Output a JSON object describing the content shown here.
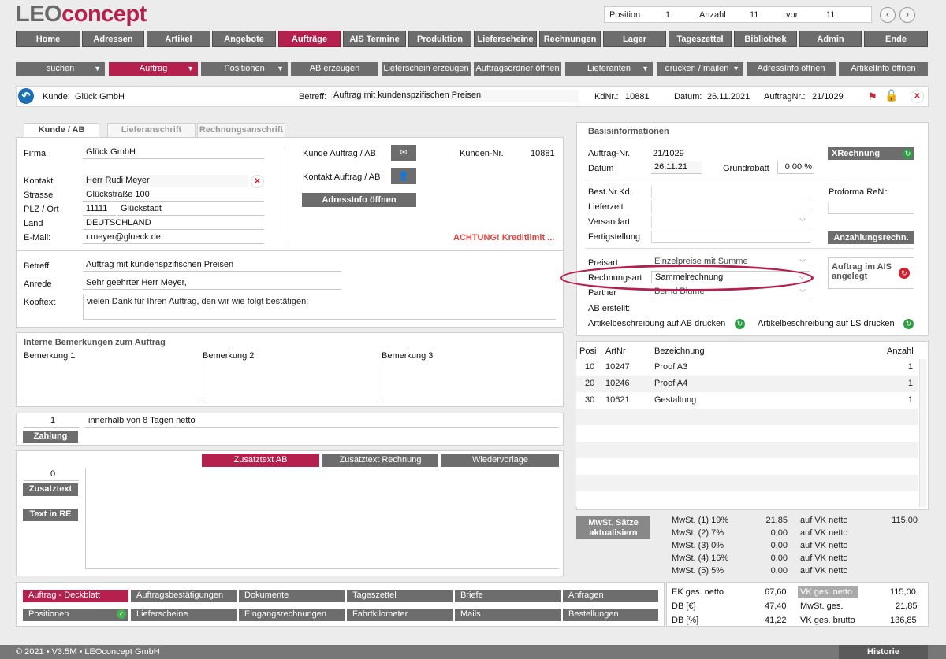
{
  "logo": {
    "part1": "LEO",
    "part2": "concept"
  },
  "position_box": {
    "position_label": "Position",
    "position_value": "1",
    "count_label": "Anzahl",
    "count_value": "11",
    "of_label": "von",
    "of_value": "11"
  },
  "nav": [
    "Home",
    "Adressen",
    "Artikel",
    "Angebote",
    "Aufträge",
    "AIS Termine",
    "Produktion",
    "Lieferscheine",
    "Rechnungen",
    "Lager",
    "Tageszettel",
    "Bibliothek",
    "Admin",
    "Ende"
  ],
  "nav_active": "Aufträge",
  "toolbar": {
    "suchen": "suchen",
    "auftrag": "Auftrag",
    "positionen": "Positionen",
    "ab_erzeugen": "AB erzeugen",
    "lieferschein": "Lieferschein erzeugen",
    "auftragsordner": "Auftragsordner öffnen",
    "lieferanten": "Lieferanten",
    "drucken": "drucken / mailen",
    "adressinfo": "AdressInfo öffnen",
    "artikelinfo": "ArtikelInfo öffnen"
  },
  "context": {
    "kunde_label": "Kunde:",
    "kunde_value": "Glück GmbH",
    "betreff_label": "Betreff:",
    "betreff_value": "Auftrag mit kundenspzifischen Preisen",
    "kdnr_label": "KdNr.:",
    "kdnr_value": "10881",
    "datum_label": "Datum:",
    "datum_value": "26.11.2021",
    "auftragnr_label": "AuftragNr.:",
    "auftragnr_value": "21/1029"
  },
  "tabs": [
    "Kunde / AB",
    "Lieferanschrift",
    "Rechnungsanschrift"
  ],
  "customer": {
    "firma_label": "Firma",
    "firma": "Glück GmbH",
    "kontakt_label": "Kontakt",
    "kontakt": "Herr Rudi Meyer",
    "strasse_label": "Strasse",
    "strasse": "Glückstraße 100",
    "plz_label": "PLZ / Ort",
    "plz": "11111",
    "ort": "Glückstadt",
    "land_label": "Land",
    "land": "DEUTSCHLAND",
    "email_label": "E-Mail:",
    "email": "r.meyer@glueck.de",
    "kunde_auftrag_label": "Kunde Auftrag / AB",
    "kontakt_auftrag_label": "Kontakt Auftrag / AB",
    "adressinfo_btn": "AdressInfo öffnen",
    "kundennr_label": "Kunden-Nr.",
    "kundennr": "10881",
    "warning": "ACHTUNG! Kreditlimit ..."
  },
  "betreff_section": {
    "betreff_label": "Betreff",
    "betreff": "Auftrag mit kundenspzifischen Preisen",
    "anrede_label": "Anrede",
    "anrede": "Sehr geehrter Herr Meyer,",
    "kopftext_label": "Kopftext",
    "kopftext": "vielen Dank für Ihren Auftrag, den wir wie folgt bestätigen:"
  },
  "remarks": {
    "title": "Interne Bemerkungen zum Auftrag",
    "b1": "Bemerkung 1",
    "b2": "Bemerkung 2",
    "b3": "Bemerkung 3"
  },
  "payment": {
    "number": "1",
    "text": "innerhalb von 8 Tagen netto",
    "button": "Zahlung"
  },
  "zusatz": {
    "tab_ab": "Zusatztext AB",
    "tab_rechnung": "Zusatztext Rechnung",
    "tab_wiedervorlage": "Wiedervorlage",
    "count": "0",
    "btn_zusatztext": "Zusatztext",
    "btn_text_in_re": "Text in RE"
  },
  "basis": {
    "title": "Basisinformationen",
    "auftragnr_label": "Auftrag-Nr.",
    "auftragnr": "21/1029",
    "datum_label": "Datum",
    "datum": "26.11.21",
    "grundrabatt_label": "Grundrabatt",
    "grundrabatt": "0,00 %",
    "xrechnung": "XRechnung",
    "best_label": "Best.Nr.Kd.",
    "lieferzeit_label": "Lieferzeit",
    "versandart_label": "Versandart",
    "fertig_label": "Fertigstellung",
    "proforma_label": "Proforma ReNr.",
    "anzahlung_btn": "Anzahlungsrechn.",
    "preisart_label": "Preisart",
    "preisart": "Einzelpreise mit Summe",
    "rechnungsart_label": "Rechnungsart",
    "rechnungsart": "Sammelrechnung",
    "partner_label": "Partner",
    "partner": "Bernd Blume",
    "ab_erstellt_label": "AB erstellt:",
    "ais_text": "Auftrag im AIS angelegt",
    "artikel_ab": "Artikelbeschreibung auf AB drucken",
    "artikel_ls": "Artikelbeschreibung auf LS drucken"
  },
  "positions_table": {
    "headers": [
      "Posi",
      "ArtNr",
      "Bezeichnung",
      "Anzahl"
    ],
    "rows": [
      [
        "10",
        "10247",
        "Proof A3",
        "1"
      ],
      [
        "20",
        "10246",
        "Proof A4",
        "1"
      ],
      [
        "30",
        "10621",
        "Gestaltung",
        "1"
      ]
    ]
  },
  "mwst": {
    "button": "MwSt. Sätze aktualisiern",
    "rows": [
      [
        "MwSt. (1) 19%",
        "21,85",
        "auf VK netto",
        "115,00"
      ],
      [
        "MwSt. (2)  7%",
        "0,00",
        "auf VK netto",
        ""
      ],
      [
        "MwSt. (3)  0%",
        "0,00",
        "auf VK netto",
        ""
      ],
      [
        "MwSt. (4) 16%",
        "0,00",
        "auf VK netto",
        ""
      ],
      [
        "MwSt. (5)  5%",
        "0,00",
        "auf VK netto",
        ""
      ]
    ]
  },
  "bottom_buttons": [
    [
      "Auftrag - Deckblatt",
      "Auftragsbestätigungen",
      "Dokumente",
      "Tageszettel",
      "Briefe",
      "Anfragen"
    ],
    [
      "Positionen",
      "Lieferscheine",
      "Eingangsrechnungen",
      "Fahrtkilometer",
      "Mails",
      "Bestellungen"
    ]
  ],
  "totals": {
    "ek_label": "EK ges. netto",
    "ek": "67,60",
    "db_eur_label": "DB [€]",
    "db_eur": "47,40",
    "db_pct_label": "DB [%]",
    "db_pct": "41,22",
    "vk_label": "VK ges. netto",
    "vk": "115,00",
    "mwst_label": "MwSt. ges.",
    "mwst": "21,85",
    "brutto_label": "VK ges. brutto",
    "brutto": "136,85"
  },
  "footer": {
    "text": "© 2021 • V3.5M • LEOconcept GmbH",
    "historie": "Historie"
  },
  "colors": {
    "accent": "#b5214f",
    "button_gray": "#6d6d6d",
    "status_green": "#2e9d45",
    "alert_red": "#e8403b"
  }
}
